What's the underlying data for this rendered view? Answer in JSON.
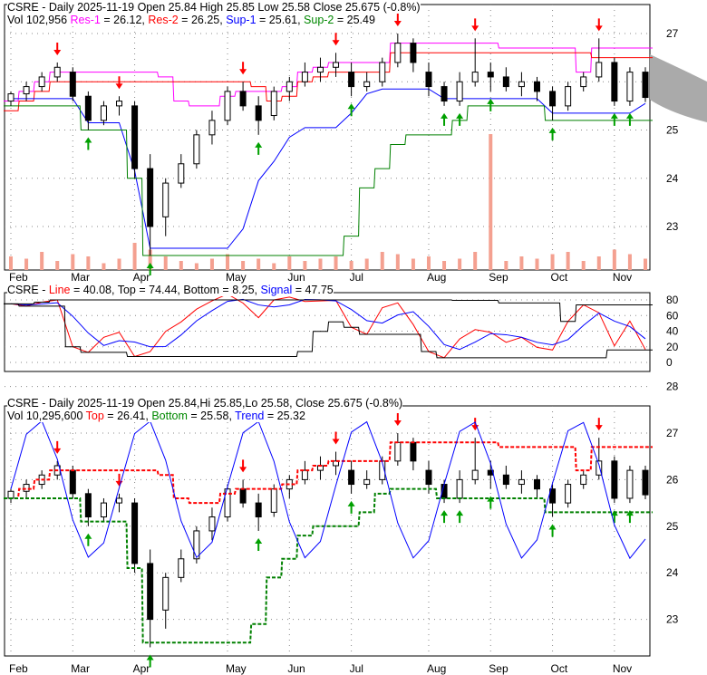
{
  "panel1": {
    "line1": {
      "text": "CSRE - Daily 2025-11-19 Open 25.84  High 25.85  Low 25.58  Close 25.675 (-0.8%)"
    },
    "vol": "Vol 102,956",
    "res1_label": "Res-1",
    "res1": " = 26.12, ",
    "res2_label": "Res-2",
    "res2": " = 26.25, ",
    "sup1_label": "Sup-1",
    "sup1": " = 25.61, ",
    "sup2_label": "Sup-2",
    "sup2": " = 25.49"
  },
  "panel2": {
    "name": "CSRE - ",
    "line_label": "Line",
    "line": " = 40.08, Top = 74.44, Bottom = 8.25, ",
    "signal_label": "Signal",
    "signal": " = 47.75"
  },
  "panel3": {
    "line1": "CSRE - Daily 2025-11-19 Open 25.84,Hi 25.85,Lo 25.58, Close 25.675 (-0.8%)",
    "vol": "Vol 10,295,600 ",
    "top_label": "Top",
    "top": " = 26.41, ",
    "bottom_label": "Bottom",
    "bottom": " = 25.58, ",
    "trend_label": "Trend",
    "trend": " = 25.32"
  },
  "colors": {
    "res1": "#ff00ff",
    "res2": "#ff0000",
    "sup1": "#0000ff",
    "sup2": "#008000",
    "up": "#00a000",
    "down": "#ff0000",
    "volume": "#f4a090",
    "band": "#a0a0a0"
  },
  "chart_data": {
    "type": "candlestick",
    "months": [
      "Feb",
      "Mar",
      "Apr",
      "May",
      "Jun",
      "Jul",
      "Aug",
      "Sep",
      "Oct",
      "Nov"
    ],
    "month_index": [
      0,
      4,
      8,
      14,
      18,
      22,
      27,
      31,
      35,
      39
    ],
    "price_ticks": [
      23,
      24,
      25,
      26,
      27
    ],
    "osc_ticks": [
      0,
      20,
      40,
      60,
      80
    ],
    "price_ticks3": [
      23,
      24,
      25,
      26,
      27,
      28
    ],
    "ohlc": [
      [
        25.6,
        25.8,
        25.5,
        25.75
      ],
      [
        25.75,
        26.0,
        25.6,
        25.9
      ],
      [
        25.9,
        26.2,
        25.8,
        26.1
      ],
      [
        26.1,
        26.4,
        26.0,
        26.3
      ],
      [
        26.2,
        26.3,
        25.6,
        25.7
      ],
      [
        25.7,
        25.8,
        25.0,
        25.2
      ],
      [
        25.2,
        25.6,
        25.1,
        25.5
      ],
      [
        25.5,
        25.7,
        25.3,
        25.6
      ],
      [
        25.5,
        25.6,
        24.0,
        24.2
      ],
      [
        24.2,
        24.5,
        22.4,
        23.0
      ],
      [
        23.2,
        24.0,
        22.8,
        23.9
      ],
      [
        23.9,
        24.5,
        23.8,
        24.3
      ],
      [
        24.3,
        25.0,
        24.2,
        24.9
      ],
      [
        24.9,
        25.4,
        24.7,
        25.2
      ],
      [
        25.2,
        25.9,
        25.1,
        25.8
      ],
      [
        25.8,
        26.0,
        25.4,
        25.5
      ],
      [
        25.5,
        25.7,
        24.9,
        25.2
      ],
      [
        25.3,
        25.9,
        25.2,
        25.8
      ],
      [
        25.8,
        26.1,
        25.6,
        26.0
      ],
      [
        26.0,
        26.4,
        25.9,
        26.2
      ],
      [
        26.2,
        26.5,
        26.0,
        26.3
      ],
      [
        26.3,
        26.6,
        26.1,
        26.4
      ],
      [
        26.2,
        26.4,
        25.7,
        25.9
      ],
      [
        25.9,
        26.2,
        25.8,
        26.0
      ],
      [
        26.0,
        26.5,
        25.9,
        26.4
      ],
      [
        26.4,
        27.0,
        26.3,
        26.8
      ],
      [
        26.8,
        26.9,
        26.2,
        26.4
      ],
      [
        26.2,
        26.4,
        25.7,
        25.9
      ],
      [
        25.9,
        26.0,
        25.5,
        25.6
      ],
      [
        25.6,
        26.2,
        25.5,
        26.0
      ],
      [
        26.0,
        26.9,
        25.9,
        26.2
      ],
      [
        26.2,
        26.4,
        25.8,
        26.1
      ],
      [
        26.1,
        26.3,
        25.8,
        25.9
      ],
      [
        25.9,
        26.2,
        25.7,
        26.0
      ],
      [
        26.0,
        26.1,
        25.6,
        25.8
      ],
      [
        25.8,
        25.9,
        25.2,
        25.5
      ],
      [
        25.5,
        26.0,
        25.4,
        25.9
      ],
      [
        25.9,
        26.2,
        25.8,
        26.1
      ],
      [
        26.1,
        26.9,
        26.0,
        26.4
      ],
      [
        26.4,
        26.5,
        25.5,
        25.6
      ],
      [
        25.6,
        26.3,
        25.5,
        26.2
      ],
      [
        26.2,
        26.3,
        25.58,
        25.675
      ]
    ],
    "volume_k": [
      30,
      25,
      40,
      20,
      35,
      30,
      15,
      25,
      60,
      45,
      30,
      20,
      15,
      25,
      35,
      20,
      25,
      15,
      30,
      20,
      25,
      30,
      20,
      25,
      40,
      35,
      25,
      30,
      20,
      25,
      40,
      300,
      20,
      30,
      25,
      35,
      40,
      20,
      30,
      45,
      35,
      25
    ]
  }
}
